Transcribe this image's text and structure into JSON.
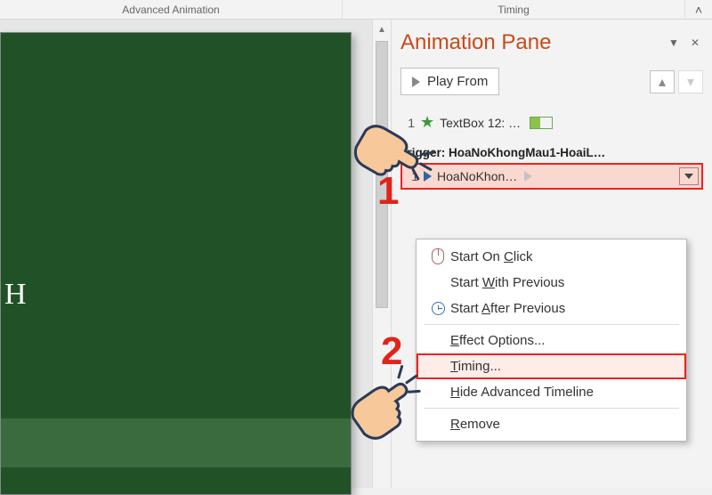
{
  "ribbon": {
    "group_advanced": "Advanced Animation",
    "group_timing": "Timing",
    "collapse_tooltip": "Collapse the Ribbon"
  },
  "slide": {
    "visible_text_fragment": "H"
  },
  "pane": {
    "title": "Animation Pane",
    "play_button": "Play From",
    "item1_index": "1",
    "item1_label": "TextBox 12: …",
    "trigger_label": "Trigger: HoaNoKhongMau1-HoaiL…",
    "item2_index": "1",
    "item2_label": "HoaNoKhon…"
  },
  "menu": {
    "start_on_click": "Start On Click",
    "start_with_prev": "Start With Previous",
    "start_after_prev": "Start After Previous",
    "effect_options": "Effect Options...",
    "timing": "Timing...",
    "hide_timeline": "Hide Advanced Timeline",
    "remove": "Remove"
  },
  "callouts": {
    "one": "1",
    "two": "2"
  },
  "colors": {
    "accent": "#c84a1a",
    "highlight_red": "#e2231a",
    "slide_bg": "#215227"
  }
}
